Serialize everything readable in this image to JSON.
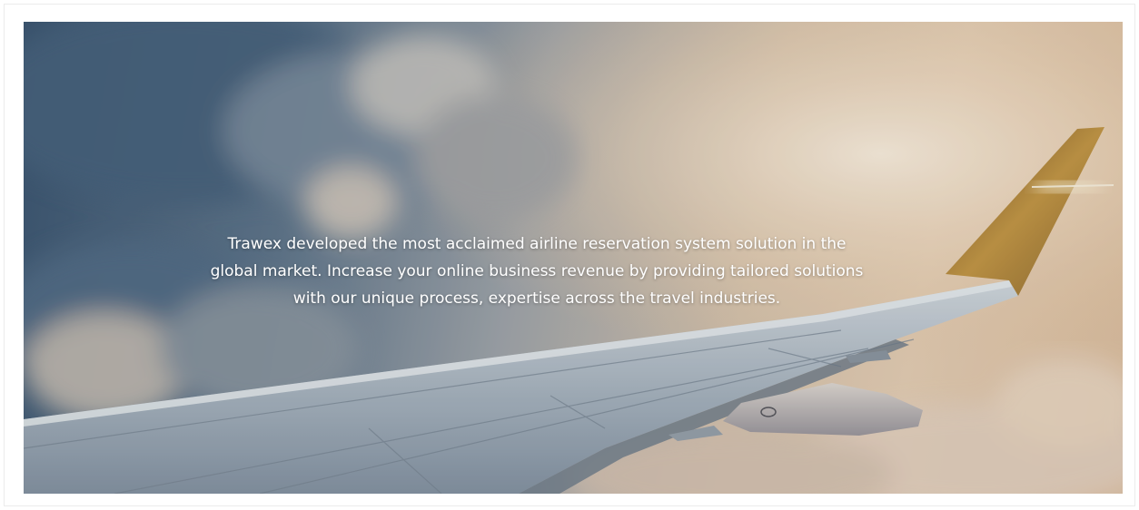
{
  "hero": {
    "lines": [
      "Trawex developed the most acclaimed airline reservation system solution in the",
      "global market. Increase your online business revenue by providing tailored solutions",
      "with our unique process, expertise  across the travel industries."
    ],
    "background_image": "airplane-wing-above-clouds",
    "colors": {
      "sky_left": "#3d5874",
      "sky_right": "#e9d2b8",
      "wing": "#c7d0d8",
      "winglet": "#b98a3c",
      "text": "#ffffff"
    }
  }
}
